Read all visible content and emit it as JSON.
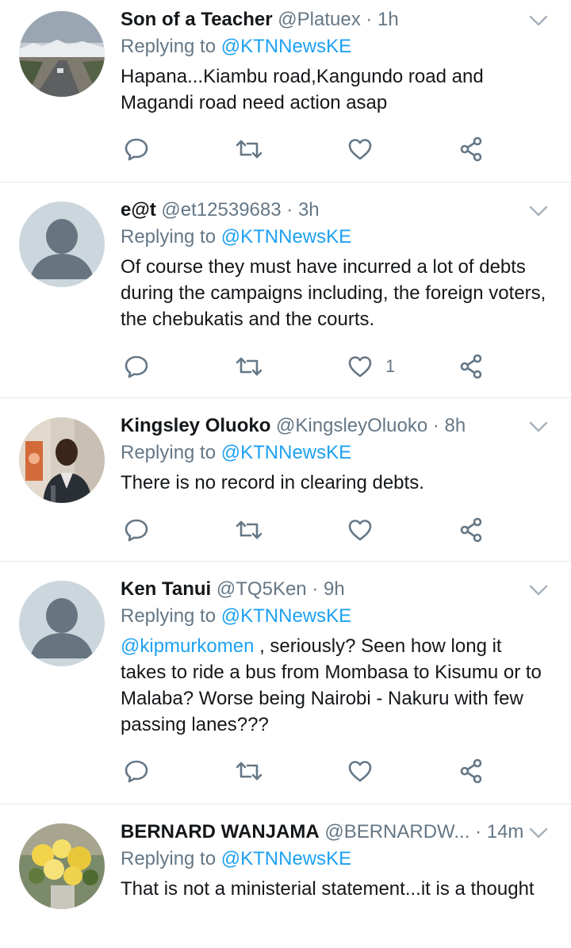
{
  "tweets": [
    {
      "name": "Son of a Teacher",
      "handle": "@Platuex",
      "dot": "·",
      "time": "1h",
      "replying_prefix": "Replying to",
      "replying_to": "@KTNNewsKE",
      "text": "Hapana...Kiambu road,Kangundo road and Magandi road need action asap",
      "like_count": "",
      "avatar": "landscape-photo"
    },
    {
      "name": "e@t",
      "handle": "@et12539683",
      "dot": "·",
      "time": "3h",
      "replying_prefix": "Replying to",
      "replying_to": "@KTNNewsKE",
      "text": "Of course they must have incurred a lot of debts during the campaigns including, the foreign voters, the chebukatis and the courts.",
      "like_count": "1",
      "avatar": "default-avatar"
    },
    {
      "name": "Kingsley Oluoko",
      "handle": "@KingsleyOluoko",
      "dot": "·",
      "time": "8h",
      "replying_prefix": "Replying to",
      "replying_to": "@KTNNewsKE",
      "text": "There is no record in clearing debts.",
      "like_count": "",
      "avatar": "person-photo"
    },
    {
      "name": "Ken Tanui",
      "handle": "@TQ5Ken",
      "dot": "·",
      "time": "9h",
      "replying_prefix": "Replying to",
      "replying_to": "@KTNNewsKE",
      "mention": "@kipmurkomen",
      "text": " , seriously? Seen how long it takes to ride a bus from Mombasa to Kisumu or to Malaba? Worse being Nairobi - Nakuru with few passing lanes???",
      "like_count": "",
      "avatar": "default-avatar"
    },
    {
      "name": "BERNARD WANJAMA",
      "handle": "@BERNARDW...",
      "dot": "·",
      "time": "14m",
      "replying_prefix": "Replying to",
      "replying_to": "@KTNNewsKE",
      "text": "That is not a ministerial statement...it is a thought",
      "like_count": "",
      "avatar": "flowers-photo"
    }
  ],
  "colors": {
    "link": "#1da1f2",
    "secondary": "#657786",
    "divider": "#e1e8ed"
  }
}
